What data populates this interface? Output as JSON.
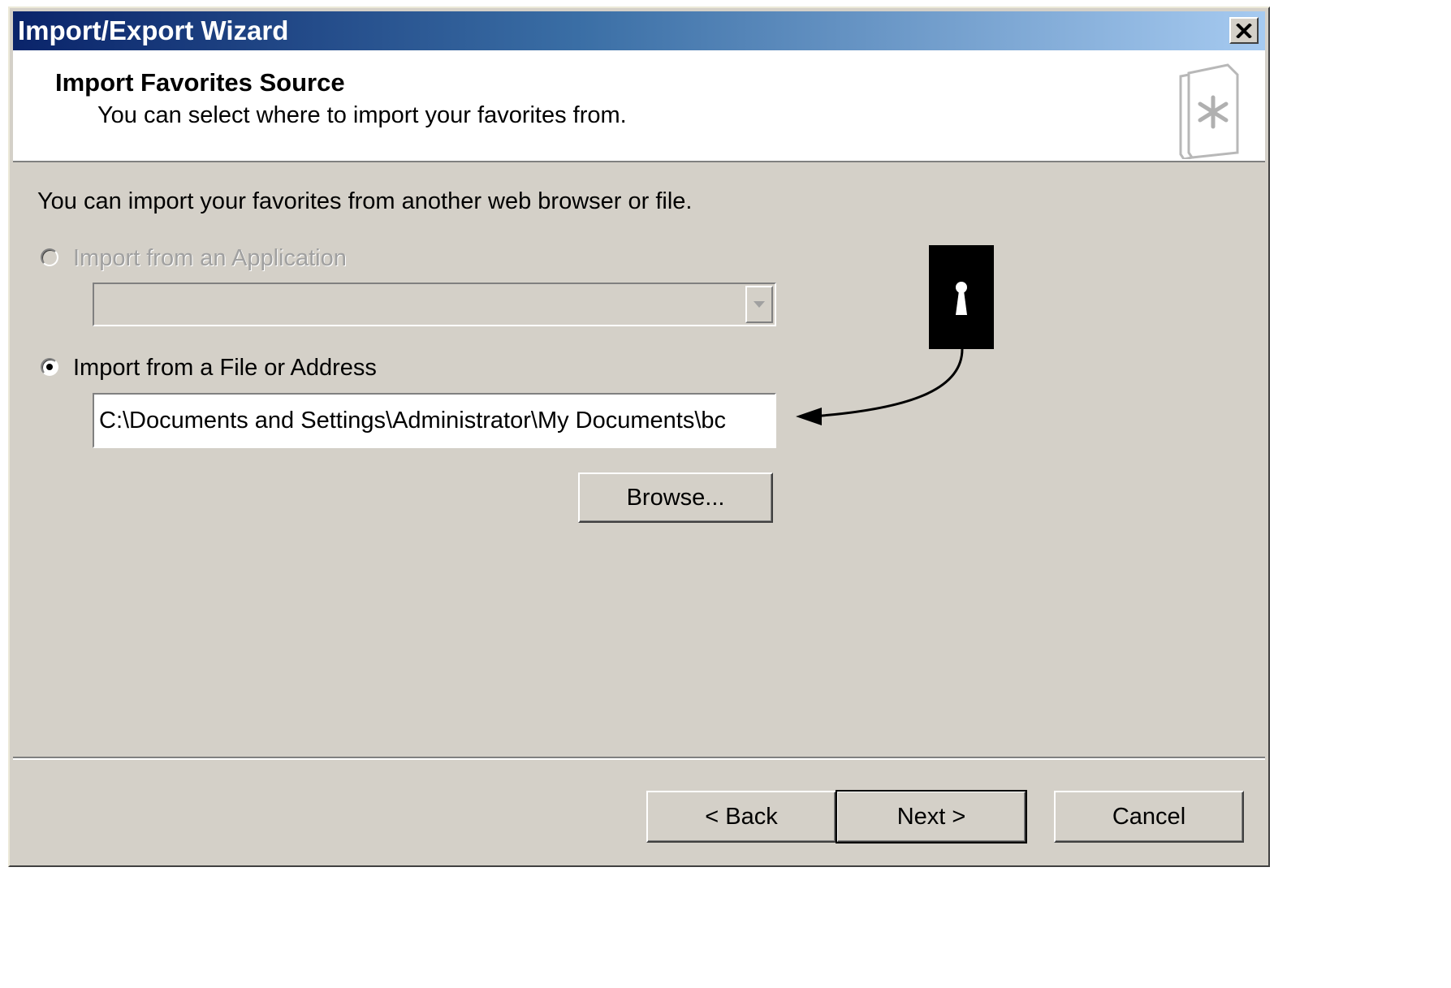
{
  "window": {
    "title": "Import/Export Wizard",
    "close_icon": "close-icon"
  },
  "header": {
    "title": "Import Favorites Source",
    "subtitle": "You can select where to import your favorites from.",
    "icon": "favorites-document-icon"
  },
  "body": {
    "intro": "You can import your favorites from another web browser or file.",
    "option_application": {
      "label": "Import from an Application",
      "selected": false,
      "enabled": false,
      "dropdown_value": ""
    },
    "option_file": {
      "label": "Import from a File or Address",
      "selected": true,
      "enabled": true,
      "path_value": "C:\\Documents and Settings\\Administrator\\My Documents\\bc"
    },
    "browse_label": "Browse..."
  },
  "footer": {
    "back_label": "< Back",
    "next_label": "Next >",
    "cancel_label": "Cancel"
  },
  "annotation": {
    "icon": "keyhole-icon"
  },
  "colors": {
    "dialog_face": "#d4d0c8",
    "title_start": "#0a246a",
    "title_end": "#a6caf0",
    "disabled_text": "#a0a0a0"
  }
}
